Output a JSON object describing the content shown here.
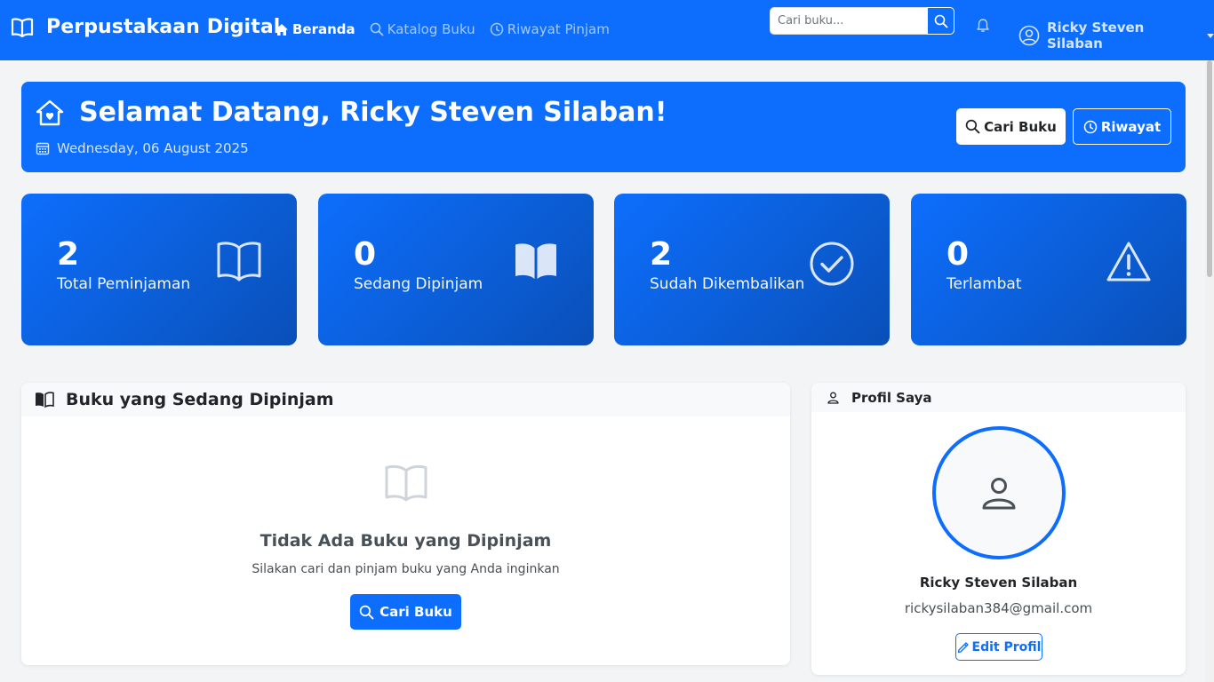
{
  "app": {
    "brand_title": "Perpustakaan Digital"
  },
  "nav": {
    "items": [
      {
        "label": "Beranda",
        "icon": "house-icon",
        "active": true
      },
      {
        "label": "Katalog Buku",
        "icon": "search-icon",
        "active": false
      },
      {
        "label": "Riwayat Pinjam",
        "icon": "clock-icon",
        "active": false
      }
    ],
    "search_placeholder": "Cari buku...",
    "user_name": "Ricky Steven Silaban"
  },
  "welcome": {
    "title": "Selamat Datang, Ricky Steven Silaban!",
    "date": "Wednesday, 06 August 2025",
    "search_button": "Cari Buku",
    "history_button": "Riwayat"
  },
  "stats": [
    {
      "value": "2",
      "label": "Total Peminjaman",
      "icon": "book-open-icon"
    },
    {
      "value": "0",
      "label": "Sedang Dipinjam",
      "icon": "book-open-fill-icon"
    },
    {
      "value": "2",
      "label": "Sudah Dikembalikan",
      "icon": "check-circle-icon"
    },
    {
      "value": "0",
      "label": "Terlambat",
      "icon": "warning-triangle-icon"
    }
  ],
  "borrowed": {
    "title": "Buku yang Sedang Dipinjam",
    "empty_title": "Tidak Ada Buku yang Dipinjam",
    "empty_subtitle": "Silakan cari dan pinjam buku yang Anda inginkan",
    "button": "Cari Buku"
  },
  "profile": {
    "title": "Profil Saya",
    "name": "Ricky Steven Silaban",
    "email": "rickysilaban384@gmail.com",
    "edit_button": "Edit Profil"
  },
  "colors": {
    "primary": "#0d6efd",
    "page_bg": "#f3f4f6",
    "panel_header": "#f8f9fa"
  }
}
